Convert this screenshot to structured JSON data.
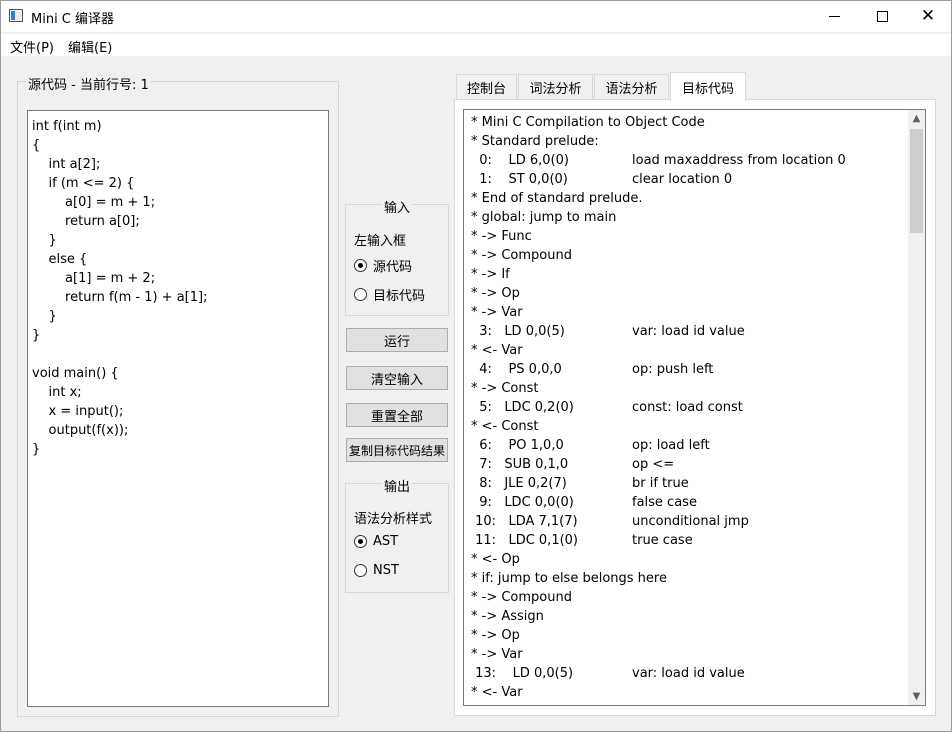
{
  "window": {
    "title": "Mini C 编译器"
  },
  "menu": {
    "file": "文件(P)",
    "edit": "编辑(E)"
  },
  "source": {
    "group_title": "源代码 - 当前行号: 1",
    "code": "int f(int m)\n{\n    int a[2];\n    if (m <= 2) {\n        a[0] = m + 1;\n        return a[0];\n    }\n    else {\n        a[1] = m + 2;\n        return f(m - 1) + a[1];\n    }\n}\n\nvoid main() {\n    int x;\n    x = input();\n    output(f(x));\n}"
  },
  "input_group": {
    "title": "输入",
    "label": "左输入框",
    "options": [
      {
        "label": "源代码",
        "checked": true
      },
      {
        "label": "目标代码",
        "checked": false
      }
    ]
  },
  "buttons": {
    "run": "运行",
    "clear_input": "清空输入",
    "reset_all": "重置全部",
    "copy_result": "复制目标代码结果"
  },
  "output_group": {
    "title": "输出",
    "label": "语法分析样式",
    "options": [
      {
        "label": "AST",
        "checked": true
      },
      {
        "label": "NST",
        "checked": false
      }
    ]
  },
  "tabs": [
    {
      "label": "控制台",
      "active": false
    },
    {
      "label": "词法分析",
      "active": false
    },
    {
      "label": "语法分析",
      "active": false
    },
    {
      "label": "目标代码",
      "active": true
    }
  ],
  "output_lines": [
    {
      "code": "* Mini C Compilation to Object Code",
      "comment": ""
    },
    {
      "code": "* Standard prelude:",
      "comment": ""
    },
    {
      "code": "  0:    LD 6,0(0)",
      "comment": "load maxaddress from location 0"
    },
    {
      "code": "  1:    ST 0,0(0)",
      "comment": "clear location 0"
    },
    {
      "code": "* End of standard prelude.",
      "comment": ""
    },
    {
      "code": "* global: jump to main",
      "comment": ""
    },
    {
      "code": "* -> Func",
      "comment": ""
    },
    {
      "code": "* -> Compound",
      "comment": ""
    },
    {
      "code": "* -> If",
      "comment": ""
    },
    {
      "code": "* -> Op",
      "comment": ""
    },
    {
      "code": "* -> Var",
      "comment": ""
    },
    {
      "code": "  3:   LD 0,0(5)",
      "comment": "var: load id value"
    },
    {
      "code": "* <- Var",
      "comment": ""
    },
    {
      "code": "  4:    PS 0,0,0",
      "comment": "op: push left"
    },
    {
      "code": "* -> Const",
      "comment": ""
    },
    {
      "code": "  5:   LDC 0,2(0)",
      "comment": "const: load const"
    },
    {
      "code": "* <- Const",
      "comment": ""
    },
    {
      "code": "  6:    PO 1,0,0",
      "comment": "op: load left"
    },
    {
      "code": "  7:   SUB 0,1,0",
      "comment": "op <="
    },
    {
      "code": "  8:   JLE 0,2(7)",
      "comment": "br if true"
    },
    {
      "code": "  9:   LDC 0,0(0)",
      "comment": "false case"
    },
    {
      "code": " 10:   LDA 7,1(7)",
      "comment": "unconditional jmp"
    },
    {
      "code": " 11:   LDC 0,1(0)",
      "comment": "true case"
    },
    {
      "code": "* <- Op",
      "comment": ""
    },
    {
      "code": "* if: jump to else belongs here",
      "comment": ""
    },
    {
      "code": "* -> Compound",
      "comment": ""
    },
    {
      "code": "* -> Assign",
      "comment": ""
    },
    {
      "code": "* -> Op",
      "comment": ""
    },
    {
      "code": "* -> Var",
      "comment": ""
    },
    {
      "code": " 13:    LD 0,0(5)",
      "comment": "var: load id value"
    },
    {
      "code": "* <- Var",
      "comment": ""
    }
  ],
  "scrollbar": {
    "position": 0.0
  }
}
